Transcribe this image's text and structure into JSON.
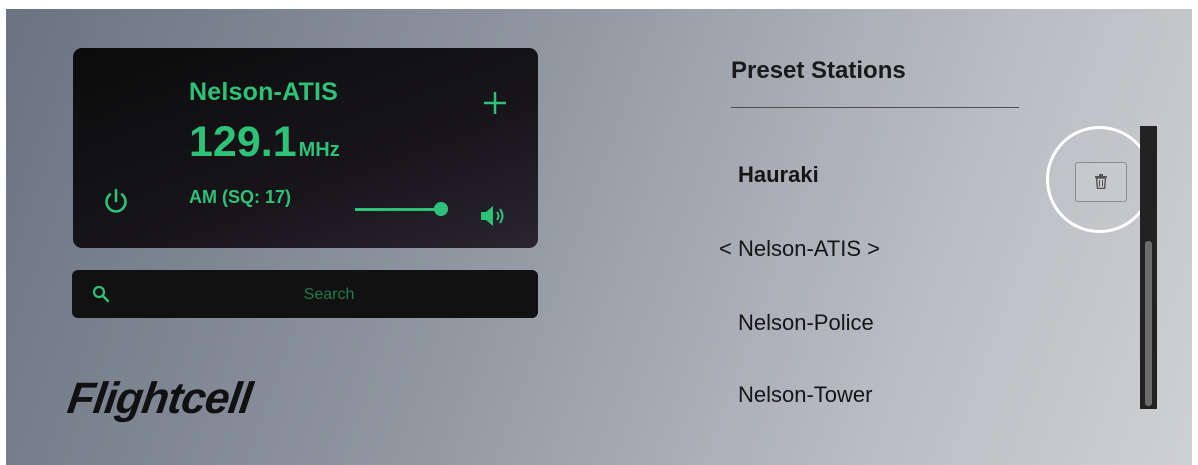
{
  "radio": {
    "station_name": "Nelson-ATIS",
    "frequency": "129.1",
    "frequency_unit": "MHz",
    "mode": "AM (SQ: 17)",
    "volume_level": 0.92,
    "add_icon": "plus-icon",
    "power_icon": "power-icon",
    "speaker_icon": "speaker-icon"
  },
  "search": {
    "placeholder": "Search",
    "value": "",
    "icon": "search-icon"
  },
  "brand": {
    "logo_text": "Flightcell"
  },
  "presets": {
    "title": "Preset Stations",
    "items": [
      {
        "label": "Hauraki",
        "selected": true
      },
      {
        "label": "< Nelson-ATIS >",
        "selected": false
      },
      {
        "label": "Nelson-Police",
        "selected": false
      },
      {
        "label": "Nelson-Tower",
        "selected": false
      }
    ],
    "delete_icon": "trash-icon"
  },
  "colors": {
    "accent": "#2ec278",
    "panel": "#111111"
  }
}
